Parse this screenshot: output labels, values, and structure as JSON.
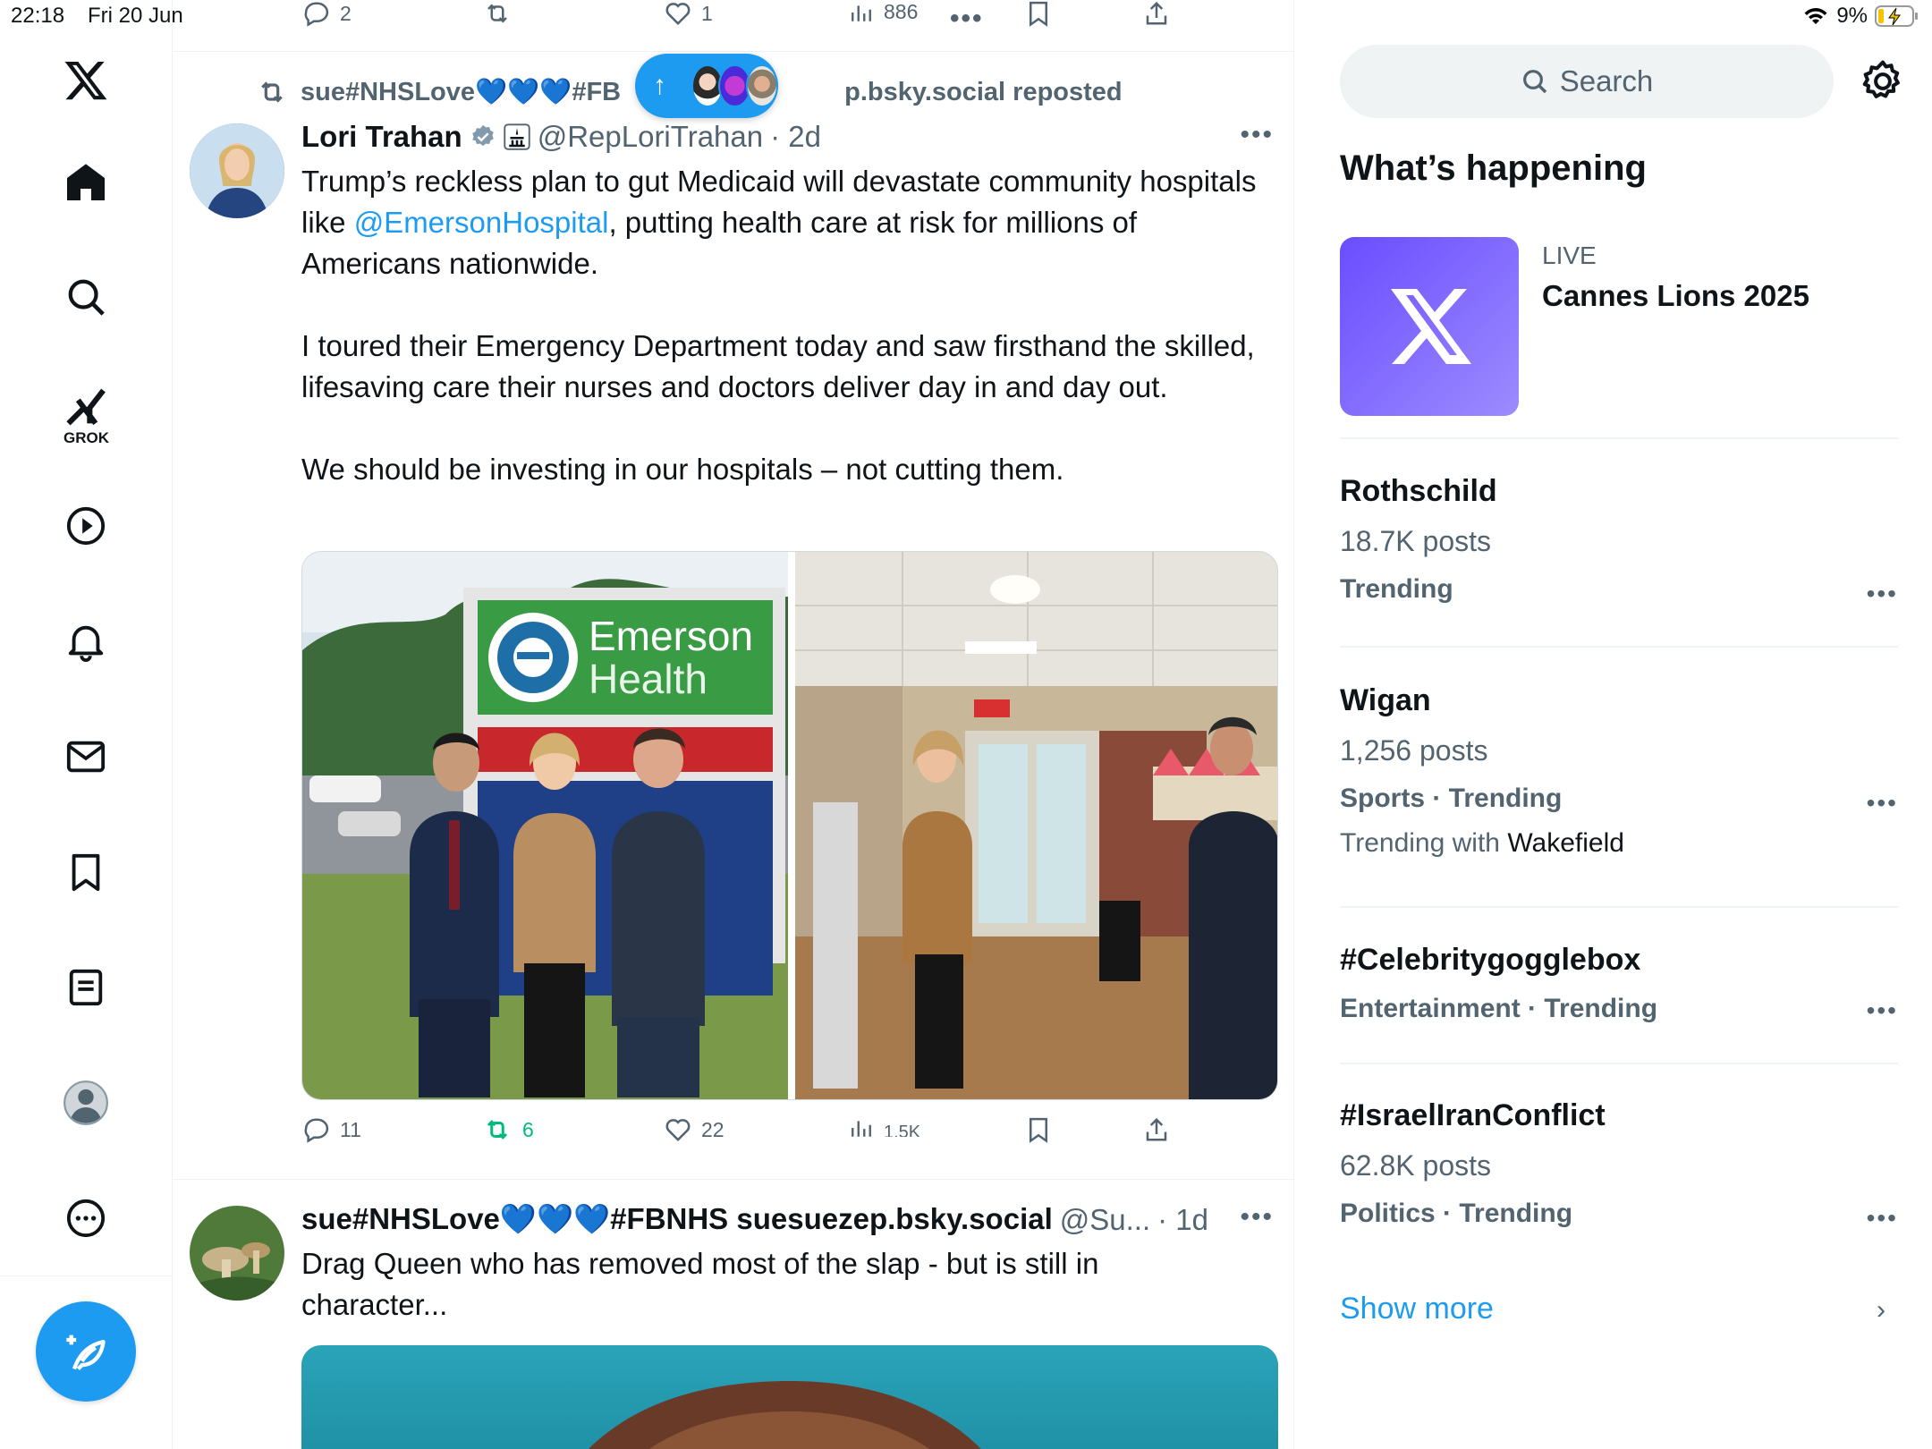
{
  "status_bar": {
    "time": "22:18",
    "date": "Fri 20 Jun",
    "battery": "9%"
  },
  "top_actions": {
    "replies": "2",
    "likes": "1",
    "views": "886"
  },
  "new_posts_pill": {
    "arrow": "↑"
  },
  "nav": {
    "grok_label": "GROK"
  },
  "post1": {
    "repost_by": "sue#NHSLove💙💙💙#FBNHS suesuezep.bsky.social reposted",
    "repost_by_left": "sue#NHSLove💙💙💙#FB",
    "repost_by_right": "p.bsky.social reposted",
    "author": "Lori Trahan",
    "handle": "@RepLoriTrahan",
    "time": "· 2d",
    "text_1a": "Trump’s reckless plan to gut Medicaid will devastate community hospitals like ",
    "mention": "@EmersonHospital",
    "text_1b": ", putting health care at risk for millions of Americans nationwide.",
    "text_2": "I toured their Emergency Department today and saw firsthand the skilled, lifesaving care their nurses and doctors deliver day in and day out.",
    "text_3": "We should be investing in our hospitals – not cutting them.",
    "sign_line1": "Emerson",
    "sign_line2": "Health",
    "replies": "11",
    "reposts": "6",
    "likes": "22",
    "views": "1.5K"
  },
  "post2": {
    "author": "sue#NHSLove💙💙💙#FBNHS suesuezep.bsky.social",
    "handle": "@Su...",
    "time": "· 1d",
    "text": "Drag Queen who has  removed most of the slap - but is still in character..."
  },
  "right": {
    "search_placeholder": "Search",
    "whats_happening": "What’s happening",
    "live_label": "LIVE",
    "live_title": "Cannes Lions 2025",
    "trends": [
      {
        "title": "Rothschild",
        "posts": "18.7K posts",
        "category": "Trending"
      },
      {
        "title": "Wigan",
        "posts": "1,256 posts",
        "category": "Sports · Trending",
        "with_prefix": "Trending with ",
        "with": "Wakefield"
      },
      {
        "title": "#Celebritygogglebox",
        "category": "Entertainment · Trending"
      },
      {
        "title": "#IsraelIranConflict",
        "posts": "62.8K posts",
        "category": "Politics · Trending"
      }
    ],
    "show_more": "Show more"
  },
  "colors": {
    "accent": "#1d9bf0",
    "repost_green": "#00ba7c",
    "muted": "#536471",
    "text": "#0f1419"
  }
}
